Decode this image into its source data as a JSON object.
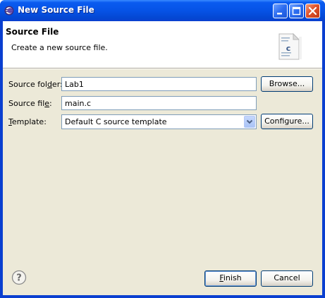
{
  "window": {
    "title": "New Source File"
  },
  "header": {
    "title": "Source File",
    "description": "Create a new source file.",
    "image_icon": "c-source-file-icon"
  },
  "form": {
    "source_folder": {
      "label_pre": "Source fol",
      "label_mnemonic": "d",
      "label_post": "er:",
      "value": "Lab1",
      "button_label": "Browse..."
    },
    "source_file": {
      "label_pre": "Source fil",
      "label_mnemonic": "e",
      "label_post": ":",
      "value": "main.c"
    },
    "template": {
      "label_mnemonic": "T",
      "label_post": "emplate:",
      "value": "Default C source template",
      "button_label": "Configure..."
    }
  },
  "footer": {
    "help_icon": "help-icon",
    "finish_mnemonic": "F",
    "finish_post": "inish",
    "cancel_label": "Cancel"
  },
  "colors": {
    "titlebar": "#0653e6",
    "dialog_bg": "#ece9d8",
    "header_bg": "#ffffff",
    "field_border": "#7f9db9",
    "button_border": "#003c74"
  }
}
